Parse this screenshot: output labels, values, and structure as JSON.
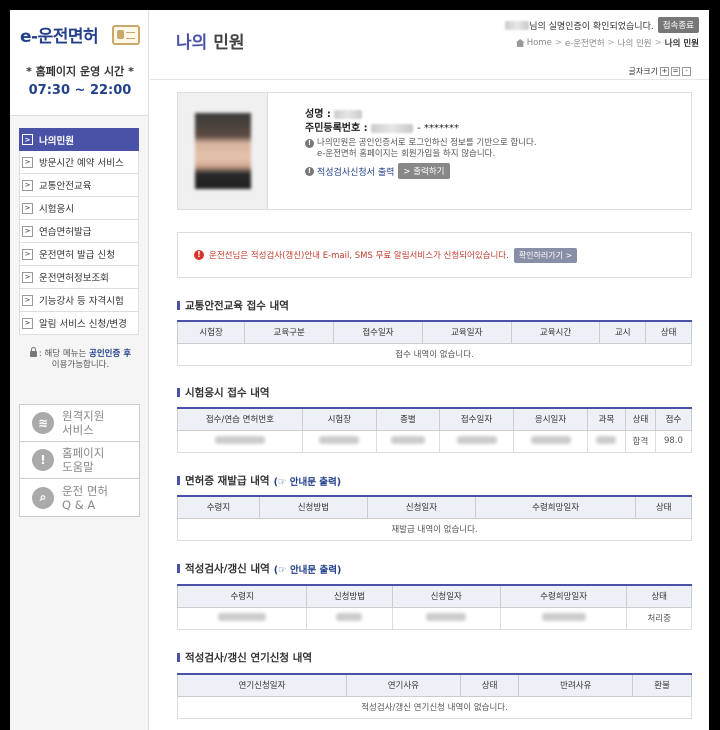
{
  "sidebar": {
    "logo": "e-운전면허",
    "hours_label": "* 홈페이지 운영 시간 *",
    "hours_time": "07:30 ~ 22:00",
    "menu": [
      {
        "label": "나의민원"
      },
      {
        "label": "방문시간 예약 서비스"
      },
      {
        "label": "교통안전교육"
      },
      {
        "label": "시험응시"
      },
      {
        "label": "연습면허발급"
      },
      {
        "label": "운전면허 발급 신청"
      },
      {
        "label": "운전면허정보조회"
      },
      {
        "label": "기능강사 등 자격시험"
      },
      {
        "label": "알림 서비스 신청/변경"
      }
    ],
    "lock_note_pre": ": 해당 메뉴는 ",
    "lock_note_hl": "공인인증 후",
    "lock_note_post": "이용가능합니다.",
    "services": [
      {
        "icon": "wifi-icon",
        "line1": "원격지원",
        "line2": "서비스"
      },
      {
        "icon": "alert-icon",
        "line1": "홈페이지",
        "line2": "도움말"
      },
      {
        "icon": "magnifier-icon",
        "line1": "운전 면허",
        "line2": "Q & A"
      }
    ]
  },
  "header": {
    "title_hl": "나의",
    "title_rest": " 민원",
    "login_suffix": "님의 실명인증이 확인되었습니다.",
    "logout": "접속종료",
    "crumbs": [
      "Home",
      "e-운전면허",
      "나의 민원",
      "나의 민원"
    ],
    "font_size_label": "글자크기",
    "font_plus": "+",
    "font_reset": "=",
    "font_minus": "-"
  },
  "profile": {
    "name_label": "성명 :",
    "reg_label": "주민등록번호 :",
    "reg_mask": "- *******",
    "note1": "나의민원은 공인인증서로 로그인하신 정보를 기반으로 합니다.",
    "note2": "e-운전면허 홈페이지는 회원가입을 하지 않습니다.",
    "print_label": "적성검사신청서 출력",
    "print_button": "> 출력하기"
  },
  "alert": {
    "text": "운전선님은 적성검사(갱신)안내 E-mail, SMS 무료 알림서비스가 신청되어있습니다.",
    "button": "확인하러가기 >"
  },
  "sections": {
    "s1": {
      "title": "교통안전교육 접수 내역",
      "headers": [
        "시험장",
        "교육구분",
        "접수일자",
        "교육일자",
        "교육시간",
        "교시",
        "상태"
      ],
      "empty": "접수 내역이 없습니다."
    },
    "s2": {
      "title": "시험응시 접수 내역",
      "headers": [
        "접수/연습 면허번호",
        "시험장",
        "종별",
        "접수일자",
        "응시일자",
        "과목",
        "상태",
        "점수"
      ],
      "status": "합격",
      "score": "98.0"
    },
    "s3": {
      "title": "면허증 재발급 내역",
      "link": "(☞ 안내문 출력)",
      "headers": [
        "수령지",
        "신청방법",
        "신청일자",
        "수령희망일자",
        "상태"
      ],
      "empty": "재발급 내역이 없습니다."
    },
    "s4": {
      "title": "적성검사/갱신 내역",
      "link": "(☞ 안내문 출력)",
      "headers": [
        "수령지",
        "신청방법",
        "신청일자",
        "수령희망일자",
        "상태"
      ],
      "status": "처리중"
    },
    "s5": {
      "title": "적성검사/갱신 연기신청 내역",
      "headers": [
        "연기신청일자",
        "연기사유",
        "상태",
        "반려사유",
        "환불"
      ],
      "empty": "적성검사/갱신 연기신청 내역이 없습니다."
    }
  }
}
